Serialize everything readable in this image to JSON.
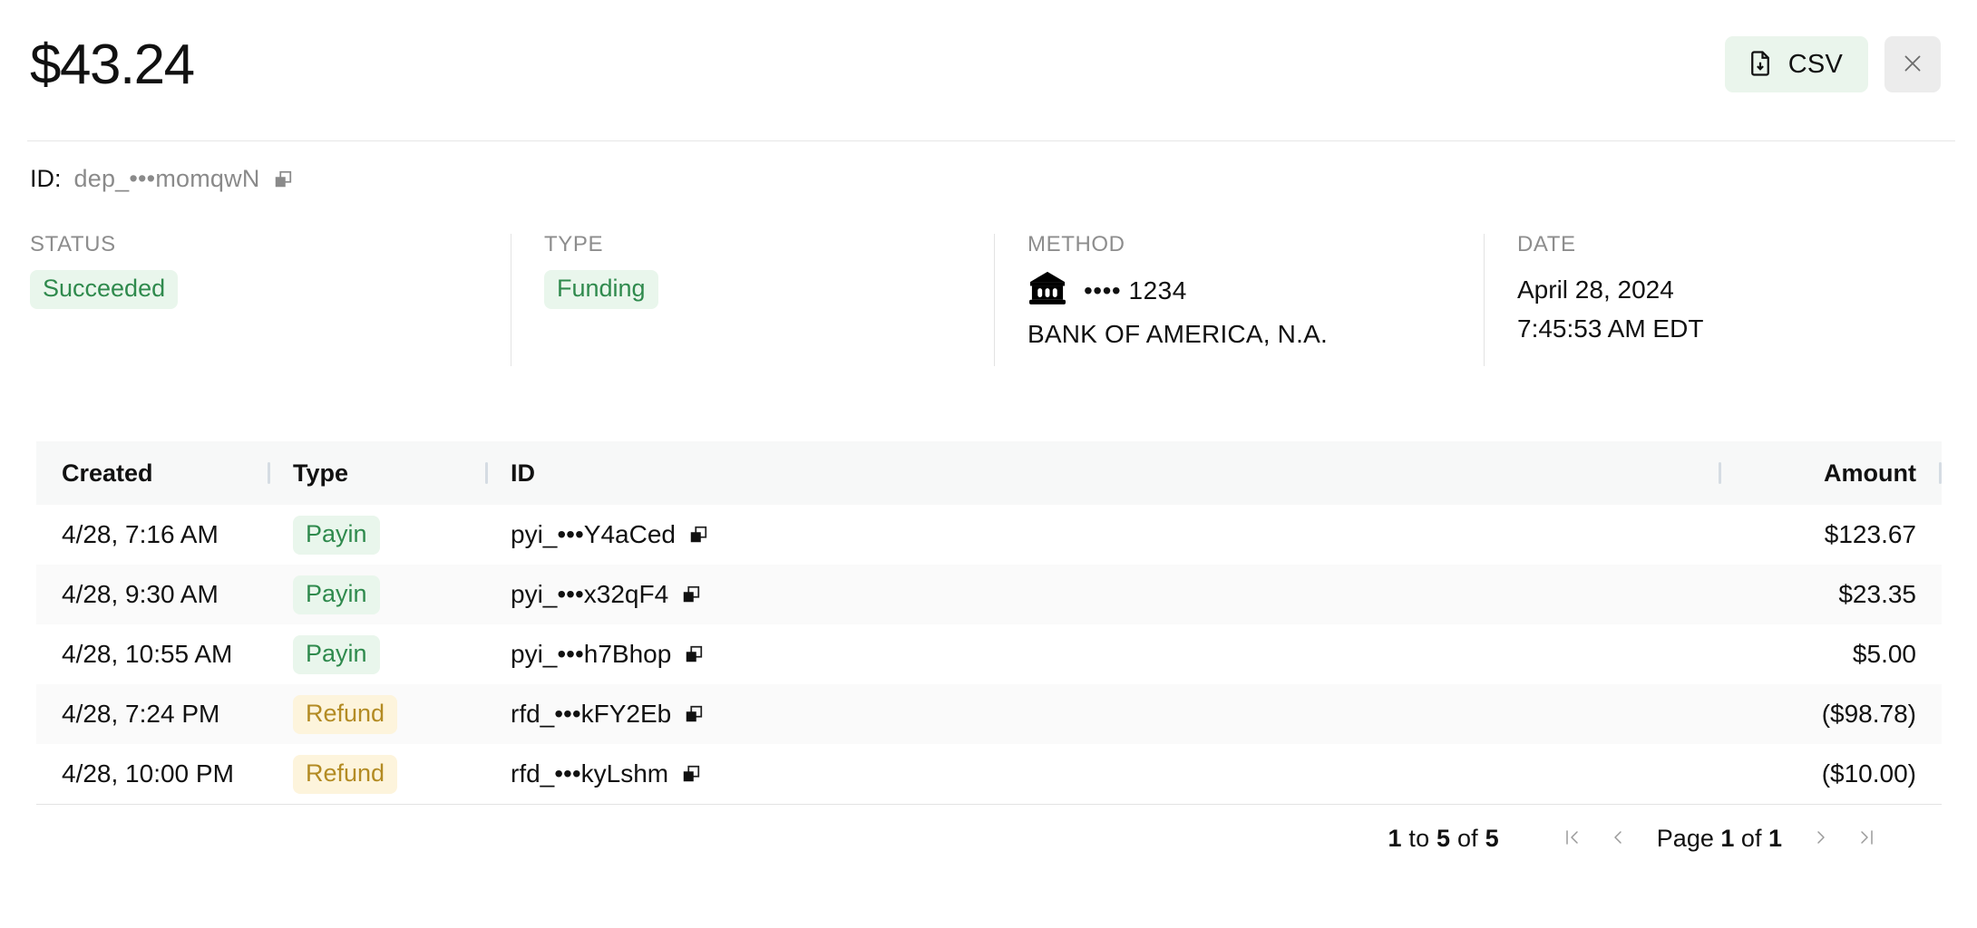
{
  "header": {
    "amount_title": "$43.24",
    "csv_button_label": "CSV",
    "csv_icon": "file-download-icon",
    "close_icon": "close-icon"
  },
  "identifier": {
    "key_label": "ID:",
    "value": "dep_•••momqwN",
    "copy_icon": "copy-icon"
  },
  "info": {
    "status": {
      "label": "STATUS",
      "value": "Succeeded",
      "badge_color": "#2f8a4d",
      "badge_bg": "#e9f6ec"
    },
    "type": {
      "label": "TYPE",
      "value": "Funding",
      "badge_color": "#2f8a4d",
      "badge_bg": "#e9f6ec"
    },
    "method": {
      "label": "METHOD",
      "icon": "bank-icon",
      "mask": "•••• 1234",
      "bank_name": "BANK OF AMERICA, N.A."
    },
    "date": {
      "label": "DATE",
      "day": "April 28, 2024",
      "time": "7:45:53 AM EDT"
    }
  },
  "table": {
    "columns": [
      "Created",
      "Type",
      "ID",
      "Amount"
    ],
    "rows": [
      {
        "created": "4/28, 7:16 AM",
        "type": "Payin",
        "type_style": "green",
        "id": "pyi_•••Y4aCed",
        "amount": "$123.67"
      },
      {
        "created": "4/28, 9:30 AM",
        "type": "Payin",
        "type_style": "green",
        "id": "pyi_•••x32qF4",
        "amount": "$23.35"
      },
      {
        "created": "4/28, 10:55 AM",
        "type": "Payin",
        "type_style": "green",
        "id": "pyi_•••h7Bhop",
        "amount": "$5.00"
      },
      {
        "created": "4/28, 7:24 PM",
        "type": "Refund",
        "type_style": "amber",
        "id": "rfd_•••kFY2Eb",
        "amount": "($98.78)"
      },
      {
        "created": "4/28, 10:00 PM",
        "type": "Refund",
        "type_style": "amber",
        "id": "rfd_•••kyLshm",
        "amount": "($10.00)"
      }
    ]
  },
  "pagination": {
    "range_prefix": "1",
    "range_to": "to",
    "range_middle": "5",
    "range_of": "of",
    "range_total": "5",
    "page_word": "Page",
    "page_current": "1",
    "page_of": "of",
    "page_total": "1",
    "first_icon": "first-page-icon",
    "prev_icon": "chevron-left-icon",
    "next_icon": "chevron-right-icon",
    "last_icon": "last-page-icon"
  },
  "colors": {
    "accent_green": "#2f8a4d",
    "badge_green_bg": "#e9f6ec",
    "accent_amber": "#b38b23",
    "badge_amber_bg": "#fdf4dc",
    "divider": "#e3e3e3",
    "header_row_bg": "#f7f8f8"
  }
}
